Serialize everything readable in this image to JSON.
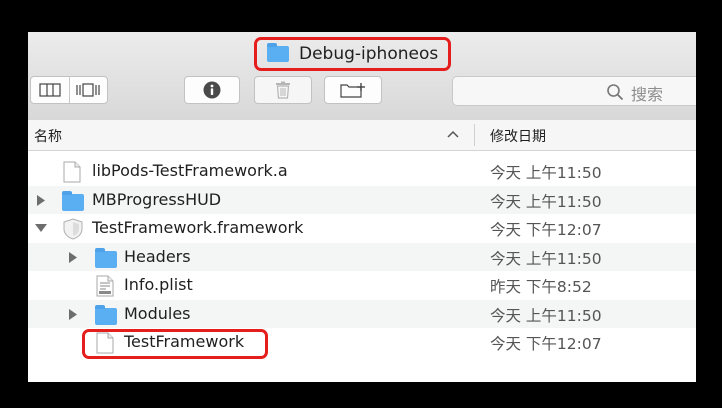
{
  "window": {
    "title": "Debug-iphoneos"
  },
  "toolbar": {
    "view_modes": [
      "columns-view-icon",
      "coverflow-view-icon"
    ],
    "info_icon": "info-icon",
    "trash_icon": "trash-icon",
    "new_folder_icon": "new-folder-icon",
    "search_placeholder": "搜索"
  },
  "columns": {
    "name": "名称",
    "date": "修改日期",
    "sort": "ascending"
  },
  "files": [
    {
      "name": "libPods-TestFramework.a",
      "date": "今天 上午11:50",
      "icon": "file-icon",
      "expandable": false,
      "expanded": false
    },
    {
      "name": "MBProgressHUD",
      "date": "今天 上午11:50",
      "icon": "folder-icon",
      "expandable": true,
      "expanded": false
    },
    {
      "name": "TestFramework.framework",
      "date": "今天 下午12:07",
      "icon": "framework-icon",
      "expandable": true,
      "expanded": true
    },
    {
      "name": "Headers",
      "date": "今天 上午11:50",
      "icon": "folder-icon",
      "expandable": true,
      "expanded": false
    },
    {
      "name": "Info.plist",
      "date": "昨天 下午8:52",
      "icon": "plist-icon",
      "expandable": false,
      "expanded": false
    },
    {
      "name": "Modules",
      "date": "今天 上午11:50",
      "icon": "folder-icon",
      "expandable": true,
      "expanded": false
    },
    {
      "name": "TestFramework",
      "date": "今天 下午12:07",
      "icon": "file-icon",
      "expandable": false,
      "expanded": false
    }
  ],
  "colors": {
    "highlight": "#e51d1d",
    "folder": "#5aaef2"
  }
}
